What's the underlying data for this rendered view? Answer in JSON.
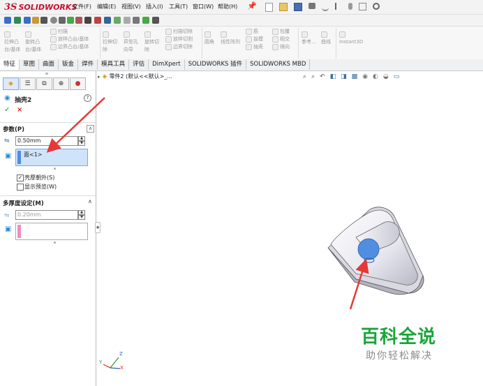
{
  "app": {
    "logo_ds": "3S",
    "logo_name": "SOLIDWORKS"
  },
  "menubar": {
    "items": [
      "文件(F)",
      "编辑(E)",
      "视图(V)",
      "插入(I)",
      "工具(T)",
      "窗口(W)",
      "帮助(H)"
    ],
    "pin_icon": "pin-icon"
  },
  "ribbon": {
    "groups": [
      {
        "labels": [
          "拉伸凸",
          "台/基体"
        ]
      },
      {
        "labels": [
          "旋转凸",
          "台/基体"
        ]
      },
      {
        "labels": [
          "扫描",
          "放样凸台/基体",
          "边界凸台/基体"
        ]
      },
      {
        "labels": [
          "拉伸切",
          "除"
        ]
      },
      {
        "labels": [
          "异型孔",
          "向导"
        ]
      },
      {
        "labels": [
          "旋转切",
          "除"
        ]
      },
      {
        "labels": [
          "扫描切除",
          "放样切割",
          "边界切除"
        ]
      },
      {
        "labels": [
          "圆角"
        ]
      },
      {
        "labels": [
          "线性阵列"
        ]
      },
      {
        "labels": [
          "筋",
          "拔模",
          "抽壳"
        ]
      },
      {
        "labels": [
          "包覆",
          "相交",
          "镜向"
        ]
      },
      {
        "labels": [
          "参考..."
        ]
      },
      {
        "labels": [
          "曲线"
        ]
      },
      {
        "labels": [
          "Instant3D"
        ]
      }
    ]
  },
  "tabs": [
    "特征",
    "草图",
    "曲面",
    "钣金",
    "焊件",
    "模具工具",
    "评估",
    "DimXpert",
    "SOLIDWORKS 插件",
    "SOLIDWORKS MBD"
  ],
  "tree": {
    "breadcrumb": "零件2 (默认<<默认>_..."
  },
  "property_manager": {
    "title": "抽壳2",
    "help": "?",
    "ok": "✓",
    "cancel": "×",
    "params": {
      "header": "参数(P)",
      "thickness": "0.50mm",
      "faces_item": "面<1>",
      "shell_outward": "壳厚朝外(S)",
      "show_preview": "显示预览(W)",
      "shell_outward_checked": true,
      "show_preview_checked": false
    },
    "multi": {
      "header": "多厚度设定(M)",
      "thickness": "0.20mm"
    }
  },
  "triad": {
    "x": "X",
    "y": "Y",
    "z": "Z"
  },
  "watermark": {
    "title": "百科全说",
    "subtitle": "助你轻松解决"
  },
  "colors": {
    "accent_red": "#e53935",
    "face_blue": "#4f8ee0",
    "pink_sel": "#f08cc0",
    "brand_green": "#1aa53a"
  }
}
